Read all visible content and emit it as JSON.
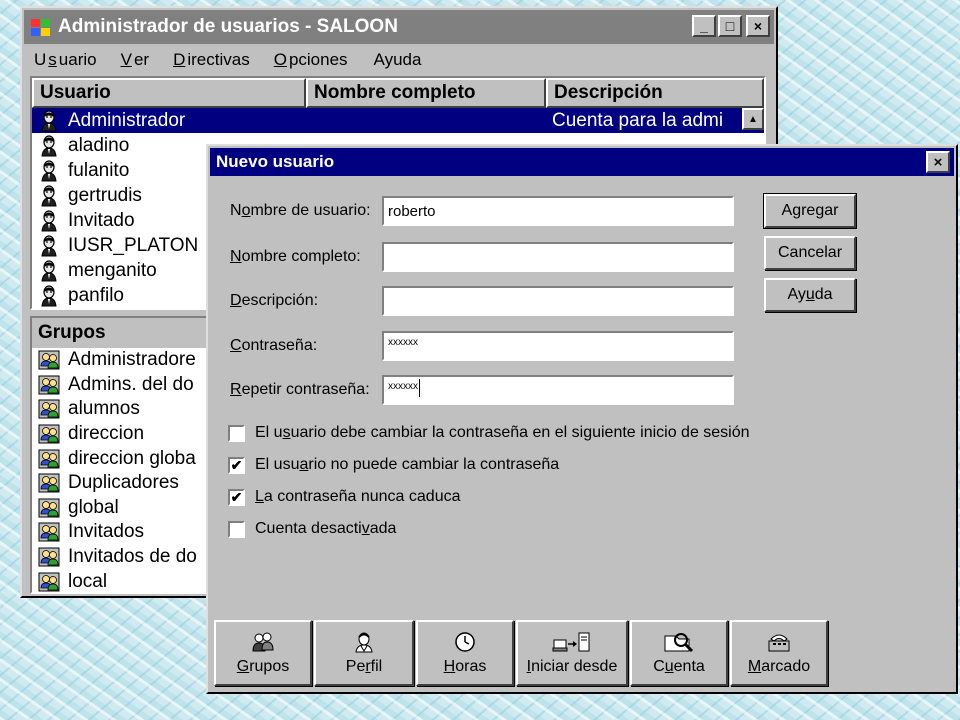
{
  "main_window": {
    "title": "Administrador de usuarios - SALOON",
    "controls": {
      "minimize": "_",
      "maximize": "□",
      "close": "×"
    },
    "menu": [
      {
        "pre": "U",
        "acc": "s",
        "post": "uario"
      },
      {
        "pre": "",
        "acc": "V",
        "post": "er"
      },
      {
        "pre": "",
        "acc": "D",
        "post": "irectivas"
      },
      {
        "pre": "",
        "acc": "O",
        "post": "pciones"
      },
      {
        "pre": "",
        "acc": "",
        "post": "Ayuda"
      }
    ],
    "users_columns": [
      "Usuario",
      "Nombre completo",
      "Descripción"
    ],
    "users": [
      {
        "name": "Administrador",
        "description": "Cuenta para la admi"
      },
      {
        "name": "aladino"
      },
      {
        "name": "fulanito"
      },
      {
        "name": "gertrudis"
      },
      {
        "name": "Invitado"
      },
      {
        "name": "IUSR_PLATON"
      },
      {
        "name": "menganito"
      },
      {
        "name": "panfilo"
      }
    ],
    "groups_header": "Grupos",
    "groups": [
      "Administradore",
      "Admins. del do",
      "alumnos",
      "direccion",
      "direccion globa",
      "Duplicadores",
      "global",
      "Invitados",
      "Invitados de do",
      "local"
    ]
  },
  "dialog": {
    "title": "Nuevo usuario",
    "close": "×",
    "fields": {
      "username": {
        "label_pre": "N",
        "label_acc": "o",
        "label_post": "mbre de usuario:",
        "value": "roberto"
      },
      "fullname": {
        "label_pre": "",
        "label_acc": "N",
        "label_post": "ombre completo:",
        "value": ""
      },
      "description": {
        "label_pre": "",
        "label_acc": "D",
        "label_post": "escripción:",
        "value": ""
      },
      "password": {
        "label_pre": "",
        "label_acc": "C",
        "label_post": "ontraseña:",
        "value": "xxxxxx"
      },
      "password_repeat": {
        "label_pre": "",
        "label_acc": "R",
        "label_post": "epetir contraseña:",
        "value": "xxxxxx"
      }
    },
    "buttons": {
      "add": "Agregar",
      "cancel": "Cancelar",
      "help_pre": "Ay",
      "help_acc": "u",
      "help_post": "da"
    },
    "checkboxes": [
      {
        "pre": "El u",
        "acc": "s",
        "post": "uario debe cambiar la contraseña en el siguiente inicio de sesión",
        "checked": false
      },
      {
        "pre": "El usu",
        "acc": "a",
        "post": "rio no puede cambiar la contraseña",
        "checked": true
      },
      {
        "pre": "",
        "acc": "L",
        "post": "a contraseña nunca caduca",
        "checked": true
      },
      {
        "pre": "Cuenta desacti",
        "acc": "v",
        "post": "ada",
        "checked": false
      }
    ],
    "check_mark": "✔",
    "bottom_buttons": [
      {
        "pre": "",
        "acc": "G",
        "post": "rupos",
        "icon": "groups-icon"
      },
      {
        "pre": "Pe",
        "acc": "r",
        "post": "fil",
        "icon": "profile-icon"
      },
      {
        "pre": "",
        "acc": "H",
        "post": "oras",
        "icon": "clock-icon"
      },
      {
        "pre": "",
        "acc": "I",
        "post": "niciar desde",
        "icon": "logon-to-icon"
      },
      {
        "pre": "C",
        "acc": "u",
        "post": "enta",
        "icon": "account-icon"
      },
      {
        "pre": "",
        "acc": "M",
        "post": "arcado",
        "icon": "dialin-icon"
      }
    ]
  },
  "colors": {
    "selection": "#000080",
    "face": "#c0c0c0",
    "active_title": "#000080",
    "inactive_title": "#808080"
  }
}
